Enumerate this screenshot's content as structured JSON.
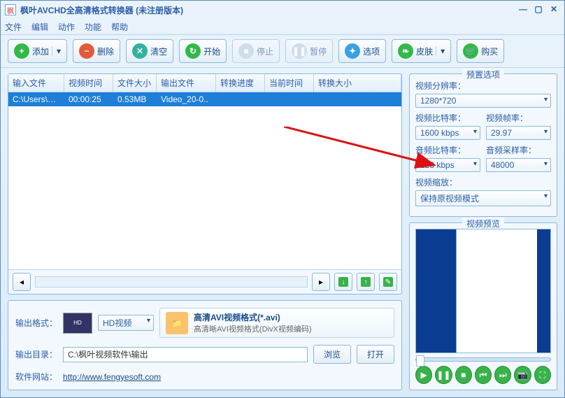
{
  "title": "枫叶AVCHD全高清格式转换器   (未注册版本)",
  "menu": {
    "file": "文件",
    "edit": "编辑",
    "action": "动作",
    "func": "功能",
    "help": "帮助"
  },
  "toolbar": {
    "add": "添加",
    "delete": "删除",
    "clear": "清空",
    "start": "开始",
    "stop": "停止",
    "pause": "暂停",
    "options": "选项",
    "skin": "皮肤",
    "buy": "购买"
  },
  "cols": {
    "input": "输入文件",
    "vtime": "视频时间",
    "size": "文件大小",
    "output": "输出文件",
    "progress": "转换进度",
    "curtime": "当前时间",
    "osize": "转换大小"
  },
  "row": {
    "input": "C:\\Users\\pc\\..",
    "vtime": "00:00:25",
    "size": "0.53MB",
    "output": "Video_20-0..",
    "progress": "",
    "curtime": "",
    "osize": ""
  },
  "out": {
    "format_label": "输出格式：",
    "hd": "HD视频",
    "fmt_title": "高清AVI视频格式(*.avi)",
    "fmt_sub": "高清晰AVI视频格式(DivX视频编码)",
    "dir_label": "输出目录：",
    "dir": "C:\\枫叶视频软件\\输出",
    "browse": "浏览",
    "open": "打开",
    "site_label": "软件网站：",
    "site": "http://www.fengyesoft.com"
  },
  "preset": {
    "title": "预置选项",
    "res_label": "视频分辨率：",
    "res": "1280*720",
    "vbit_label": "视频比特率：",
    "vbit": "1600 kbps",
    "fps_label": "视频帧率：",
    "fps": "29.97",
    "abit_label": "音频比特率：",
    "abit": "128 kbps",
    "asr_label": "音频采样率：",
    "asr": "48000",
    "scale_label": "视频缩放：",
    "scale": "保持原视频模式"
  },
  "preview": {
    "title": "视频预览"
  }
}
